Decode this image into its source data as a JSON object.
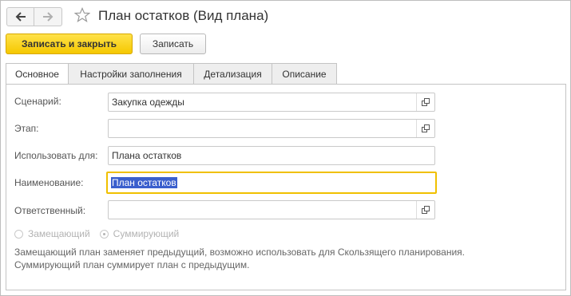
{
  "window": {
    "title": "План остатков (Вид плана)"
  },
  "nav": {
    "back_icon": "arrow-left-icon",
    "forward_icon": "arrow-right-icon",
    "favorite_icon": "star-icon"
  },
  "toolbar": {
    "save_close_label": "Записать и закрыть",
    "save_label": "Записать"
  },
  "tabs": [
    {
      "label": "Основное",
      "active": true
    },
    {
      "label": "Настройки заполнения",
      "active": false
    },
    {
      "label": "Детализация",
      "active": false
    },
    {
      "label": "Описание",
      "active": false
    }
  ],
  "form": {
    "scenario": {
      "label": "Сценарий:",
      "value": "Закупка одежды"
    },
    "stage": {
      "label": "Этап:",
      "value": ""
    },
    "use_for": {
      "label": "Использовать для:",
      "value": "Плана остатков"
    },
    "name": {
      "label": "Наименование:",
      "value": "План остатков"
    },
    "responsible": {
      "label": "Ответственный:",
      "value": ""
    }
  },
  "mode": {
    "replacing_label": "Замещающий",
    "summing_label": "Суммирующий",
    "selected": "Суммирующий",
    "note_line1": "Замещающий план заменяет предыдущий, возможно использовать для Скользящего планирования.",
    "note_line2": "Суммирующий план суммирует план с предыдущим."
  },
  "colors": {
    "primary_button": "#f5c800",
    "focus_border": "#f0c000",
    "selection": "#3a5fcd"
  }
}
